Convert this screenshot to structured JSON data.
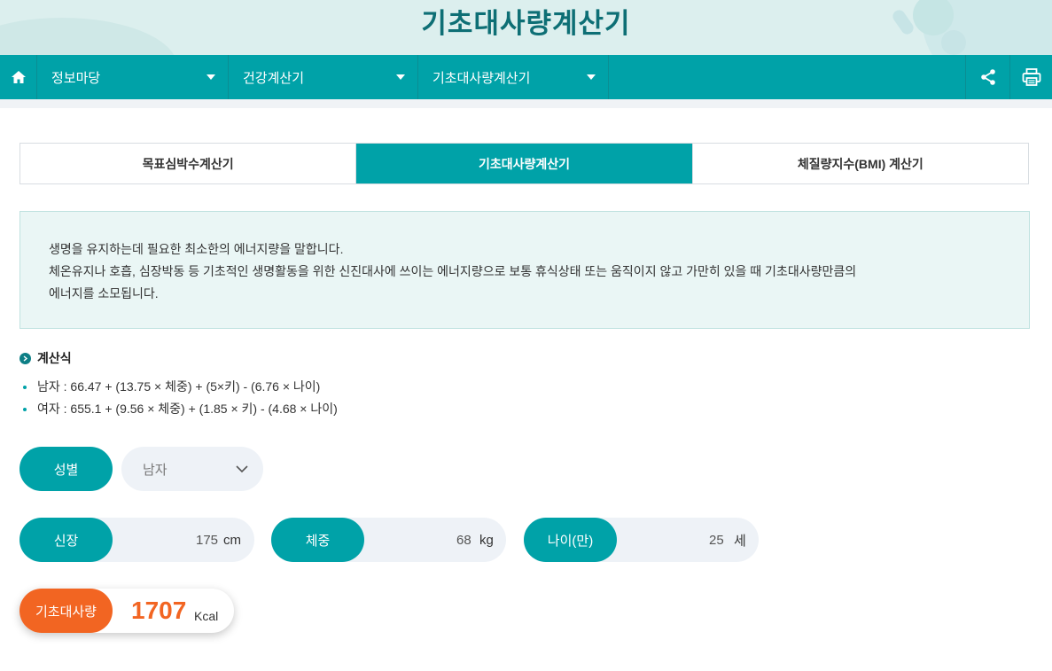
{
  "header": {
    "title": "기초대사량계산기"
  },
  "nav": {
    "items": [
      {
        "label": "정보마당"
      },
      {
        "label": "건강계산기"
      },
      {
        "label": "기초대사량계산기"
      }
    ],
    "icons": [
      "home-icon",
      "share-icon",
      "print-icon"
    ],
    "bar_color": "#00a2a8"
  },
  "tabs": [
    {
      "label": "목표심박수계산기",
      "active": false
    },
    {
      "label": "기초대사량계산기",
      "active": true
    },
    {
      "label": "체질량지수(BMI) 계산기",
      "active": false
    }
  ],
  "description": {
    "line1": "생명을 유지하는데 필요한 최소한의 에너지량을 말합니다.",
    "line2": "체온유지나 호흡, 심장박동 등 기초적인 생명활동을 위한 신진대사에 쓰이는 에너지량으로 보통 휴식상태 또는 움직이지 않고 가만히 있을 때 기초대사량만큼의",
    "line3": "에너지를 소모됩니다."
  },
  "formula": {
    "title": "계산식",
    "items": [
      "남자 : 66.47 + (13.75 × 체중) + (5×키) - (6.76 × 나이)",
      "여자 : 655.1 + (9.56 × 체중) + (1.85 × 키) - (4.68 × 나이)"
    ]
  },
  "form": {
    "gender": {
      "label": "성별",
      "value": "남자"
    },
    "height": {
      "label": "신장",
      "value": "175",
      "unit": "cm"
    },
    "weight": {
      "label": "체중",
      "value": "68",
      "unit": "kg"
    },
    "age": {
      "label": "나이(만)",
      "value": "25",
      "unit": "세"
    }
  },
  "result": {
    "label": "기초대사량",
    "value": "1707",
    "unit": "Kcal",
    "color": "#f26522"
  }
}
